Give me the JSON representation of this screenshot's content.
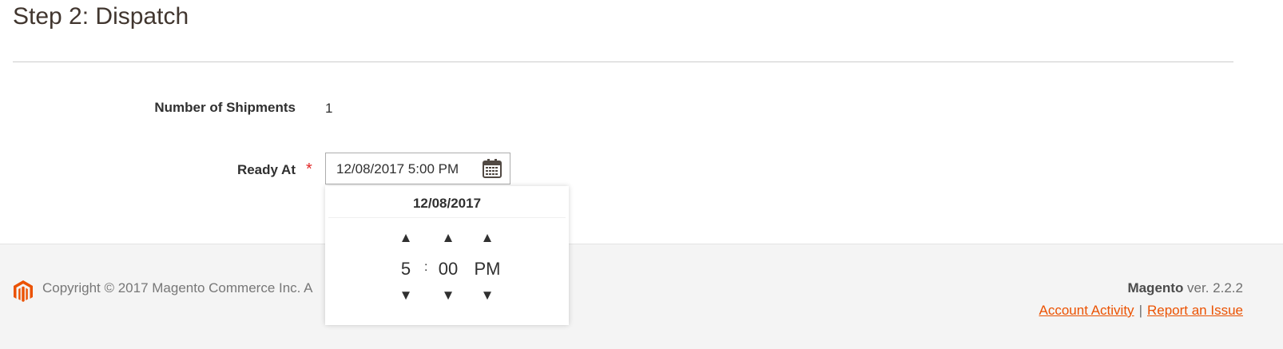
{
  "page": {
    "title": "Step 2: Dispatch"
  },
  "form": {
    "shipments": {
      "label": "Number of Shipments",
      "value": "1"
    },
    "ready_at": {
      "label": "Ready At",
      "required_mark": "*",
      "value": "12/08/2017 5:00 PM"
    }
  },
  "time_picker": {
    "date": "12/08/2017",
    "up_arrow": "▲",
    "down_arrow": "▼",
    "hour": "5",
    "separator": ":",
    "minute": "00",
    "meridiem": "PM"
  },
  "footer": {
    "copyright": "Copyright © 2017 Magento Commerce Inc. A",
    "version_brand": "Magento",
    "version_text": " ver. 2.2.2",
    "account_activity": "Account Activity",
    "pipe": "|",
    "report_issue": "Report an Issue"
  },
  "colors": {
    "accent": "#eb5202",
    "required": "#e22626",
    "footer_bg": "#f4f4f4"
  },
  "icons": {
    "calendar": "calendar-icon",
    "logo": "magento-logo-icon"
  }
}
